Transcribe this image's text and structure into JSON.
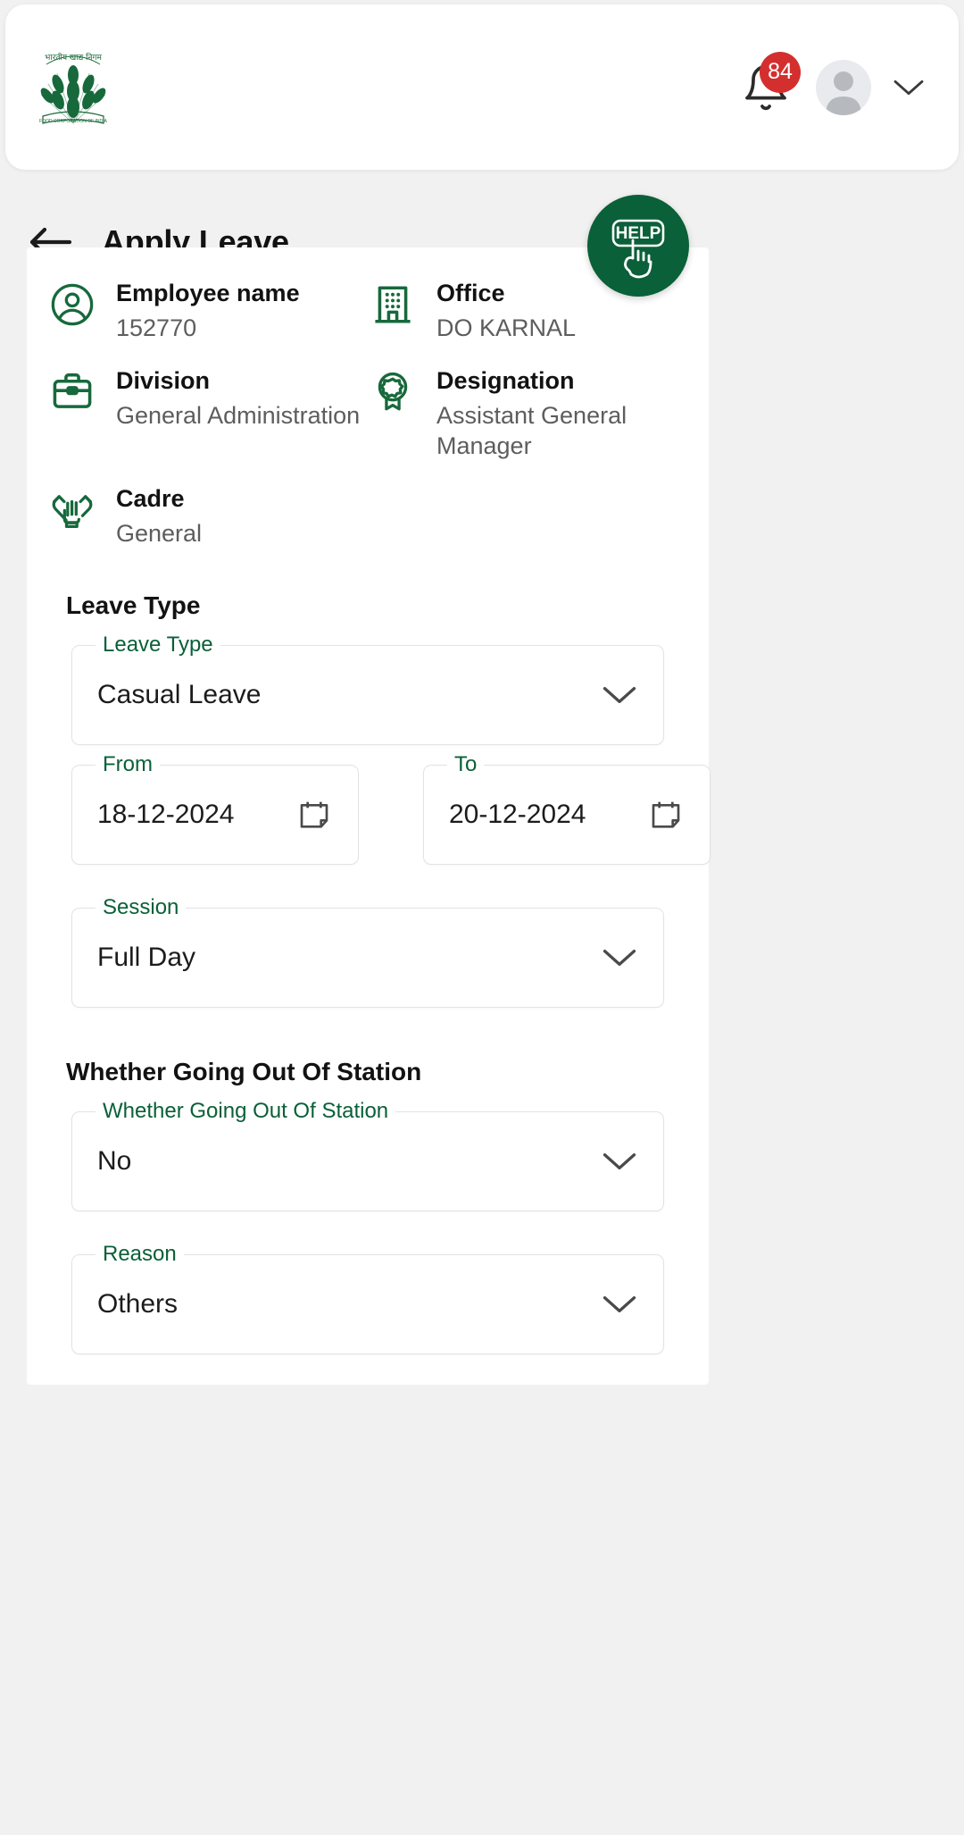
{
  "appbar": {
    "logo_alt": "Food Corporation of India logo",
    "logo_text_hi": "भारतीय खाद्य निगम",
    "notification_count": "84",
    "notification_icon": "bell-icon",
    "avatar_icon": "user-avatar-icon",
    "account_chevron_icon": "chevron-down-icon"
  },
  "header": {
    "back_icon": "arrow-left-icon",
    "title": "Apply Leave"
  },
  "help_fab": {
    "label": "HELP",
    "icon": "pointing-hand-icon"
  },
  "employee_info": [
    {
      "icon": "user-circle-icon",
      "label": "Employee name",
      "value": "152770"
    },
    {
      "icon": "building-icon",
      "label": "Office",
      "value": "DO  KARNAL"
    },
    {
      "icon": "briefcase-icon",
      "label": "Division",
      "value": "General Administration"
    },
    {
      "icon": "award-badge-icon",
      "label": "Designation",
      "value": "Assistant General Manager"
    },
    {
      "icon": "helping-hands-icon",
      "label": "Cadre",
      "value": "General"
    }
  ],
  "sections": {
    "leave_type_title": "Leave Type",
    "out_of_station_title": "Whether Going Out Of Station"
  },
  "fields": {
    "leave_type": {
      "legend": "Leave Type",
      "value": "Casual Leave",
      "trail_icon": "chevron-down-icon"
    },
    "from_date": {
      "legend": "From",
      "value": "18-12-2024",
      "trail_icon": "calendar-icon"
    },
    "to_date": {
      "legend": "To",
      "value": "20-12-2024",
      "trail_icon": "calendar-icon"
    },
    "session": {
      "legend": "Session",
      "value": "Full Day",
      "trail_icon": "chevron-down-icon"
    },
    "out_of_station": {
      "legend": "Whether Going Out Of Station",
      "value": "No",
      "trail_icon": "chevron-down-icon"
    },
    "reason": {
      "legend": "Reason",
      "value": "Others",
      "trail_icon": "chevron-down-icon"
    }
  },
  "colors": {
    "brand_green": "#0a6038",
    "badge_red": "#d32f2f",
    "page_bg": "#f1f1f1"
  }
}
